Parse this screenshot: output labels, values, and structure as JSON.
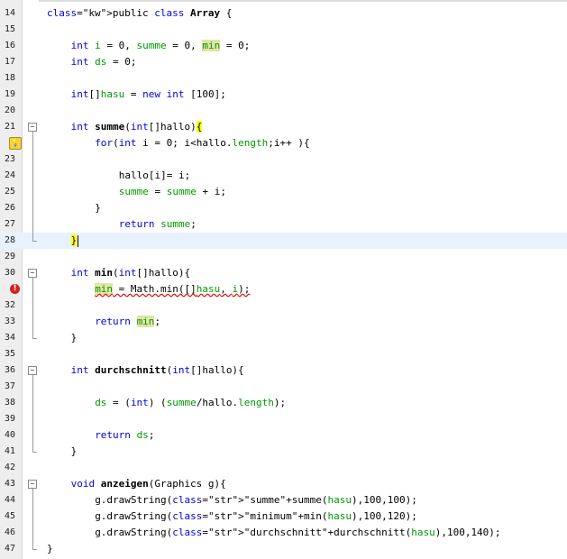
{
  "editor": {
    "lines": [
      {
        "n": "14",
        "t": "public class Array {"
      },
      {
        "n": "15",
        "t": ""
      },
      {
        "n": "16",
        "t": "int i = 0, summe = 0, min = 0;"
      },
      {
        "n": "17",
        "t": "int ds = 0;"
      },
      {
        "n": "18",
        "t": ""
      },
      {
        "n": "19",
        "t": "int[]hasu = new int [100];"
      },
      {
        "n": "20",
        "t": ""
      },
      {
        "n": "21",
        "t": "int summe(int[]hallo){"
      },
      {
        "n": "22",
        "t": "for(int i = 0; i<hallo.length;i++ ){"
      },
      {
        "n": "23",
        "t": ""
      },
      {
        "n": "24",
        "t": "hallo[i]= i;"
      },
      {
        "n": "25",
        "t": "summe = summe + i;"
      },
      {
        "n": "26",
        "t": "}"
      },
      {
        "n": "27",
        "t": "return summe;"
      },
      {
        "n": "28",
        "t": "}"
      },
      {
        "n": "29",
        "t": ""
      },
      {
        "n": "30",
        "t": "int min(int[]hallo){"
      },
      {
        "n": "31",
        "t": "min = Math.min([]hasu, i);"
      },
      {
        "n": "32",
        "t": ""
      },
      {
        "n": "33",
        "t": "return min;"
      },
      {
        "n": "34",
        "t": "}"
      },
      {
        "n": "35",
        "t": ""
      },
      {
        "n": "36",
        "t": "int durchschnitt(int[]hallo){"
      },
      {
        "n": "37",
        "t": ""
      },
      {
        "n": "38",
        "t": "ds = (int) (summe/hallo.length);"
      },
      {
        "n": "39",
        "t": ""
      },
      {
        "n": "40",
        "t": "return ds;"
      },
      {
        "n": "41",
        "t": "}"
      },
      {
        "n": "42",
        "t": ""
      },
      {
        "n": "43",
        "t": "void anzeigen(Graphics g){"
      },
      {
        "n": "44",
        "t": "g.drawString(\"summe\"+summe(hasu),100,100);"
      },
      {
        "n": "45",
        "t": "g.drawString(\"minimum\"+min(hasu),100,120);"
      },
      {
        "n": "46",
        "t": "g.drawString(\"durchschnitt\"+durchschnitt(hasu),100,140);"
      },
      {
        "n": "47",
        "t": "}"
      }
    ],
    "colors": {
      "keyword": "#0000e6",
      "field": "#009900",
      "string": "#ce7b00",
      "current_line": "#e8f2fe",
      "brace_match": "#ffff00",
      "occurrence": "#e4e4a5",
      "error": "#d42020"
    },
    "annotations": {
      "warning_line": "22",
      "error_line": "31",
      "error_icon": "error-icon",
      "warning_icon": "warning-bulb-icon",
      "current_line": "28"
    }
  }
}
